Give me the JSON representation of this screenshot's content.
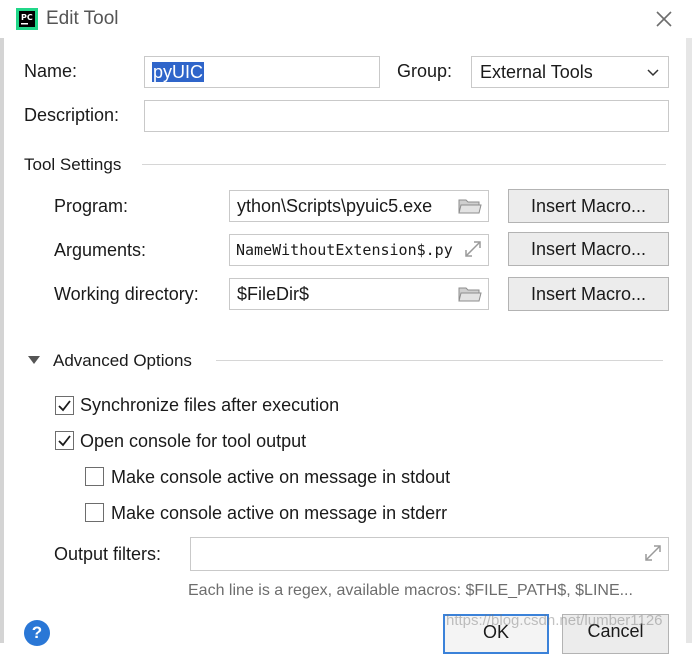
{
  "window": {
    "title": "Edit Tool",
    "app_icon": "pycharm-logo",
    "app_icon_text": "PC"
  },
  "form": {
    "name_label": "Name:",
    "name_value": "pyUIC",
    "group_label": "Group:",
    "group_value": "External Tools",
    "description_label": "Description:",
    "description_value": ""
  },
  "tool_settings": {
    "section_title": "Tool Settings",
    "program_label": "Program:",
    "program_value": "ython\\Scripts\\pyuic5.exe",
    "arguments_label": "Arguments:",
    "arguments_value": "NameWithoutExtension$.py",
    "working_dir_label": "Working directory:",
    "working_dir_value": "$FileDir$",
    "insert_macro_label": "Insert Macro..."
  },
  "advanced": {
    "section_title": "Advanced Options",
    "sync_files_label": "Synchronize files after execution",
    "sync_files_checked": true,
    "open_console_label": "Open console for tool output",
    "open_console_checked": true,
    "stdout_label": "Make console active on message in stdout",
    "stdout_checked": false,
    "stderr_label": "Make console active on message in stderr",
    "stderr_checked": false,
    "output_filters_label": "Output filters:",
    "output_filters_value": "",
    "hint": "Each line is a regex, available macros: $FILE_PATH$, $LINE..."
  },
  "footer": {
    "help_label": "?",
    "ok_label": "OK",
    "cancel_label": "Cancel",
    "watermark": "https://blog.csdn.net/lumber1126"
  },
  "colors": {
    "accent": "#2f65ca",
    "help": "#2a77d6",
    "ok_border": "#3b82d9"
  }
}
